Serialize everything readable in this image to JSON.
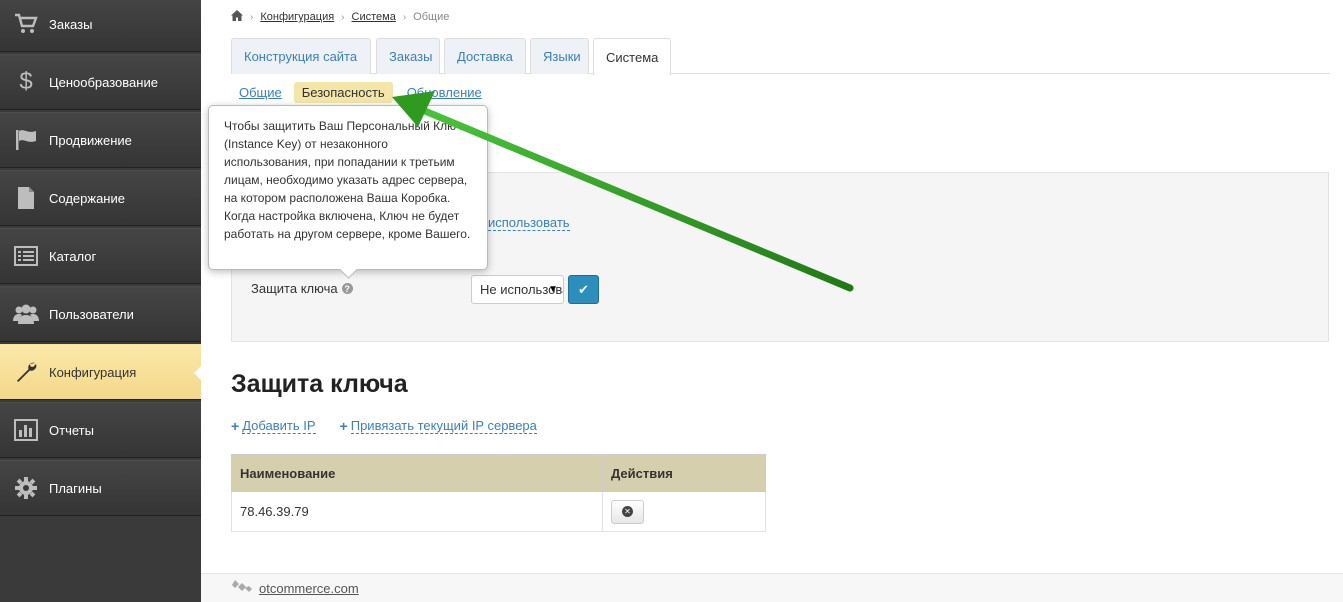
{
  "sidebar": {
    "items": [
      {
        "label": "Заказы",
        "icon": "cart-icon"
      },
      {
        "label": "Ценообразование",
        "icon": "dollar-icon"
      },
      {
        "label": "Продвижение",
        "icon": "flag-icon"
      },
      {
        "label": "Содержание",
        "icon": "document-icon"
      },
      {
        "label": "Каталог",
        "icon": "catalog-icon"
      },
      {
        "label": "Пользователи",
        "icon": "users-icon"
      },
      {
        "label": "Конфигурация",
        "icon": "wrench-icon"
      },
      {
        "label": "Отчеты",
        "icon": "chart-icon"
      },
      {
        "label": "Плагины",
        "icon": "gear-icon"
      }
    ],
    "active_index": 6
  },
  "breadcrumb": {
    "home_icon": "home-icon",
    "items": [
      "Конфигурация",
      "Система",
      "Общие"
    ]
  },
  "tabs": [
    "Конструкция сайта",
    "Заказы",
    "Доставка",
    "Языки",
    "Система"
  ],
  "active_tab": "Система",
  "subtabs": [
    "Общие",
    "Безопасность",
    "Обновление"
  ],
  "active_subtab": "Безопасность",
  "tooltip": {
    "text": "Чтобы защитить Ваш Персональный Ключ (Instance Key) от незаконного использования, при попадании к третьим лицам, необходимо указать адрес сервера, на котором расположена Ваша Коробка. Когда настройка включена, Ключ не будет работать на другом сервере, кроме Вашего."
  },
  "panel": {
    "use_link": "использовать",
    "field_label": "Защита ключа",
    "select_value": "Не использовать",
    "ok_icon": "check-icon"
  },
  "section": {
    "title": "Защита ключа",
    "add_ip": "Добавить IP",
    "bind_ip": "Привязать текущий IP сервера"
  },
  "table": {
    "headers": [
      "Наименование",
      "Действия"
    ],
    "rows": [
      [
        "78.46.39.79"
      ]
    ]
  },
  "footer": {
    "link": "otcommerce.com"
  },
  "colors": {
    "accent": "#3a7fc1",
    "active_sidebar": "#f3d88a",
    "arrow": "#2e9a1e",
    "table_header": "#d6cfae"
  }
}
